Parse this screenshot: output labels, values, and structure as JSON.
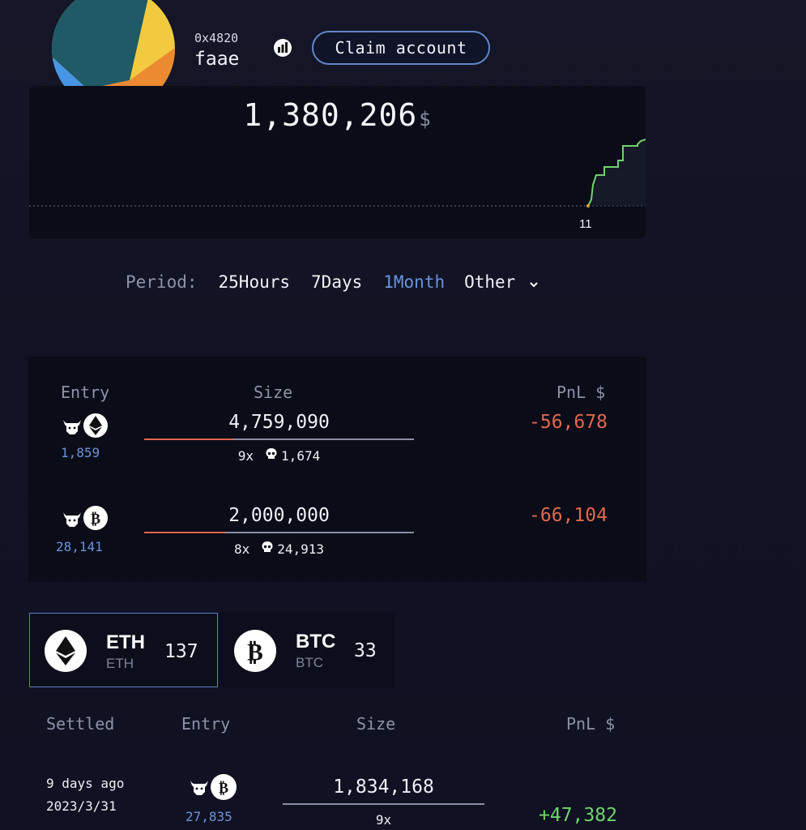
{
  "profile": {
    "address": "0x4820",
    "username": "faae",
    "claim_label": "Claim account",
    "badge_icon": "chart-badge-icon"
  },
  "chart": {
    "balance": "1,380,206",
    "currency": "$",
    "x_tick": "11",
    "line_color": "#6ed46b"
  },
  "period": {
    "label": "Period:",
    "options": [
      "25Hours",
      "7Days",
      "1Month",
      "Other"
    ],
    "active": "1Month"
  },
  "positions": {
    "headers": {
      "entry": "Entry",
      "size": "Size",
      "pnl": "PnL $"
    },
    "rows": [
      {
        "asset": "ETH",
        "side_icon": "bull-icon",
        "entry": "1,859",
        "size": "4,759,090",
        "leverage": "9x",
        "liquidation": "1,674",
        "pnl": "-56,678",
        "bar_fill": 0.33
      },
      {
        "asset": "BTC",
        "side_icon": "bull-icon",
        "entry": "28,141",
        "size": "2,000,000",
        "leverage": "8x",
        "liquidation": "24,913",
        "pnl": "-66,104",
        "bar_fill": 0.3
      }
    ]
  },
  "asset_tabs": [
    {
      "name": "ETH",
      "sub": "ETH",
      "count": "137",
      "selected": true
    },
    {
      "name": "BTC",
      "sub": "BTC",
      "count": "33",
      "selected": false
    }
  ],
  "settled": {
    "headers": {
      "settled": "Settled",
      "entry": "Entry",
      "size": "Size",
      "pnl": "PnL $"
    },
    "rows": [
      {
        "ago": "9 days ago",
        "date": "2023/3/31",
        "asset": "BTC",
        "entry": "27,835",
        "size": "1,834,168",
        "leverage": "9x",
        "pnl": "+47,382"
      }
    ]
  },
  "colors": {
    "accent_blue": "#6c93dc",
    "negative": "#e0684e",
    "positive": "#6ed46b",
    "panel": "#0a0c17"
  }
}
